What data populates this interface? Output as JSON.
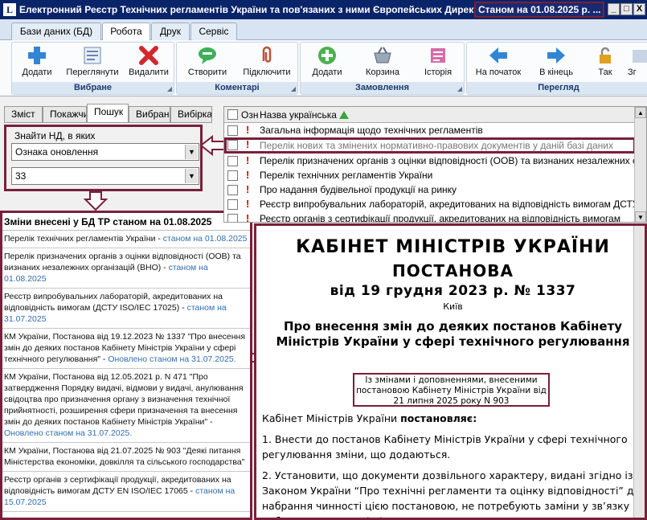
{
  "titlebar": {
    "title": "Електронний Реєстр Технічних регламентів України та пов'язаних з ними Європейських Директив",
    "date_badge": "Станом на 01.08.2025 р. ...",
    "icon_glyph": "L",
    "minimize": "_",
    "maximize": "□",
    "close": "X"
  },
  "ribbon_tabs": [
    "Бази даних (БД)",
    "Робота",
    "Друк",
    "Сервіс"
  ],
  "ribbon": {
    "groups": [
      {
        "title": "Вибране",
        "buttons": [
          "Додати",
          "Переглянути",
          "Видалити"
        ]
      },
      {
        "title": "Коментарі",
        "buttons": [
          "Створити",
          "Підключити"
        ]
      },
      {
        "title": "Замовлення",
        "buttons": [
          "Додати",
          "Корзина",
          "Історія"
        ]
      },
      {
        "title": "Перегляд",
        "buttons": [
          "На початок",
          "В кінець",
          "Так",
          "Зг"
        ]
      }
    ]
  },
  "left_tabs": [
    "Зміст",
    "Покажчик",
    "Пошук",
    "Вибране",
    "Вибірка"
  ],
  "search": {
    "label": "Знайти НД, в яких",
    "field1": "Ознака оновлення",
    "field2": "33",
    "dropdown_glyph": "▼"
  },
  "changes": {
    "title": "Зміни внесені у БД ТР станом на 01.08.2025",
    "items": [
      {
        "text": "Перелік технічних регламентів України - ",
        "date": "станом на 01.08.2025"
      },
      {
        "text": "Перелік призначених органів з оцінки відповідності (ООВ) та визнаних незалежних організацій (ВНО) - ",
        "date": "станом на 01.08.2025"
      },
      {
        "text": "Реєстр випробувальних лабораторій, акредитованих на відповідність вимогам (ДСТУ ISO/IEC 17025) - ",
        "date": "станом на 31.07.2025"
      },
      {
        "text": "КМ України, Постанова від 19.12.2023 № 1337 \"Про внесення змін до деяких постанов Кабінету Міністрів України у сфері технічного регулювання\" - ",
        "date": "Оновлено станом на 31.07.2025."
      },
      {
        "text": "КМ України, Постанова від 12.05.2021 р. N 471 \"Про затвердження Порядку видачі, відмови у видачі, анулювання свідоцтва про призначення органу з визначення технічної прийнятності, розширення сфери призначення та внесення змін до деяких постанов Кабінету Міністрів України\" - ",
        "date": "Оновлено станом на 31.07.2025."
      },
      {
        "text": "КМ України, Постанова від 21.07.2025 № 903 \"Деякі питання Міністерства економіки, довкілля та сільського господарства\"",
        "date": ""
      },
      {
        "text": "Реєстр органів з сертифікації продукції, акредитованих на відповідність вимогам ДСТУ EN ISO/IEC 17065 - ",
        "date": "станом на 15.07.2025"
      }
    ]
  },
  "list": {
    "col_ozn": "Озн",
    "col_name": "Назва українська",
    "rows": [
      "Загальна інформація щодо технічних регламентів",
      "Перелік нових та змінених нормативно-правових документів у даній базі даних",
      "Перелік призначених органів з оцінки відповідності (ООВ) та визнаних незалежних організацій",
      "Перелік технічних регламентів України",
      "Про надання будівельної продукції на ринку",
      "Реєстр випробувальних лабораторій, акредитованих на відповідність вимогам ДСТУ",
      "Реєстр органів з сертифікації продукції, акредитованих на відповідність вимогам"
    ],
    "selected_index": 1,
    "bang": "!"
  },
  "document": {
    "org": "КАБІНЕТ МІНІСТРІВ УКРАЇНИ",
    "kind": "ПОСТАНОВА",
    "date": "від 19 грудня 2023 р. № 1337",
    "city": "Київ",
    "title": "Про внесення змін до деяких постанов Кабінету Міністрів України у сфері технічного регулювання",
    "amend": "Із змінами і доповненнями, внесеними постановою Кабінету Міністрів України від 21 липня 2025 року N 903",
    "lead": "Кабінет Міністрів України ",
    "lead_bold": "постановляє:",
    "p1": "1. Внести до постанов Кабінету Міністрів України у сфері технічного регулювання зміни, що додаються.",
    "p2": "2. Установити, що документи дозвільного характеру, видані згідно із Законом України “Про технічні регламенти та оцінку відповідності” до набрання чинності цією постановою, не потребують заміни у зв’язку із набранням чинності цією постановою."
  },
  "colors": {
    "accent": "#7a1f3a",
    "title_bar": "#0a246a",
    "date_link": "#2f6fb0"
  }
}
